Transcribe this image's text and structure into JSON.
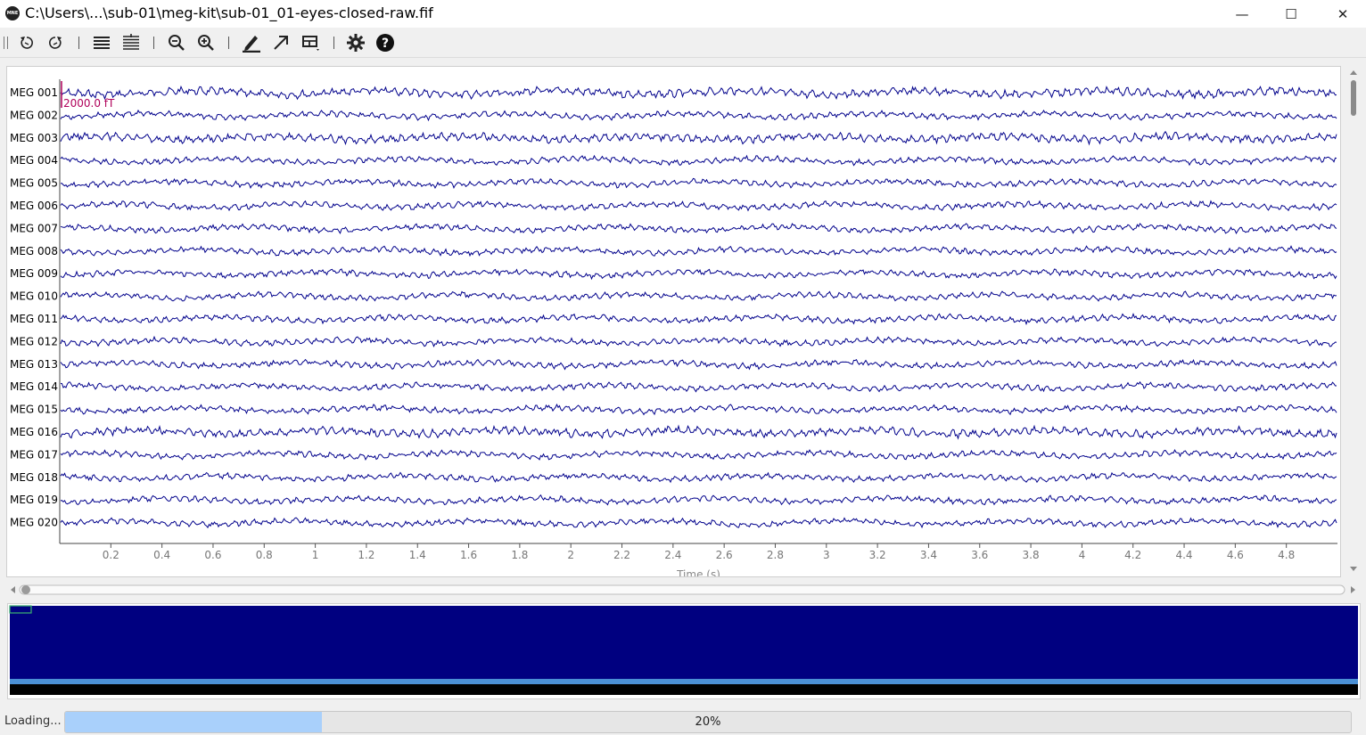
{
  "window": {
    "title": "C:\\Users\\...\\sub-01\\meg-kit\\sub-01_01-eyes-closed-raw.fif",
    "app_icon_label": "MNE",
    "minimize_glyph": "—",
    "maximize_glyph": "☐",
    "close_glyph": "✕"
  },
  "toolbar": {
    "items": [
      {
        "name": "rewind-back-icon"
      },
      {
        "name": "rewind-forward-icon"
      },
      {
        "name": "fewer-channels-icon"
      },
      {
        "name": "more-channels-icon"
      },
      {
        "name": "zoom-out-icon"
      },
      {
        "name": "zoom-in-icon"
      },
      {
        "name": "annotation-mode-icon"
      },
      {
        "name": "scale-arrow-icon"
      },
      {
        "name": "projectors-icon"
      },
      {
        "name": "settings-gear-icon"
      },
      {
        "name": "help-icon"
      }
    ]
  },
  "chart_data": {
    "type": "line",
    "title": "",
    "xlabel": "Time (s)",
    "ylabel": "",
    "xlim": [
      0,
      5
    ],
    "x_ticks": [
      "0.2",
      "0.4",
      "0.6",
      "0.8",
      "1",
      "1.2",
      "1.4",
      "1.6",
      "1.8",
      "2",
      "2.2",
      "2.4",
      "2.6",
      "2.8",
      "3",
      "3.2",
      "3.4",
      "3.6",
      "3.8",
      "4",
      "4.2",
      "4.4",
      "4.6",
      "4.8"
    ],
    "x_tick_values": [
      0.2,
      0.4,
      0.6,
      0.8,
      1.0,
      1.2,
      1.4,
      1.6,
      1.8,
      2.0,
      2.2,
      2.4,
      2.6,
      2.8,
      3.0,
      3.2,
      3.4,
      3.6,
      3.8,
      4.0,
      4.2,
      4.4,
      4.6,
      4.8
    ],
    "channels": [
      "MEG 001",
      "MEG 002",
      "MEG 003",
      "MEG 004",
      "MEG 005",
      "MEG 006",
      "MEG 007",
      "MEG 008",
      "MEG 009",
      "MEG 010",
      "MEG 011",
      "MEG 012",
      "MEG 013",
      "MEG 014",
      "MEG 015",
      "MEG 016",
      "MEG 017",
      "MEG 018",
      "MEG 019",
      "MEG 020"
    ],
    "scale_bar_label": "2000.0 fT",
    "trace_color": "#00008b",
    "scale_bar_color": "#b0005a"
  },
  "overview": {
    "background_color": "#000080",
    "band_color": "#4a8fd4",
    "viewport_color": "#3cb371"
  },
  "status": {
    "text": "Loading...",
    "progress_percent": 20,
    "progress_label": "20%"
  }
}
